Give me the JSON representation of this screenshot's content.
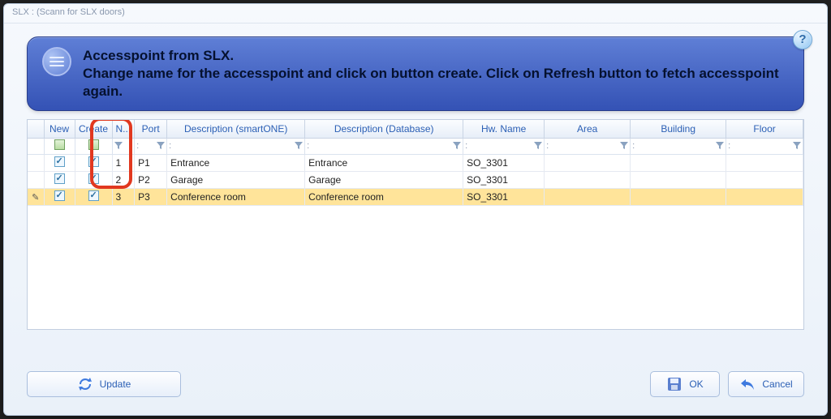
{
  "title": "SLX :  (Scann for SLX doors)",
  "help": "?",
  "banner": {
    "line1": "Accesspoint from SLX.",
    "line2": "Change name for the accesspoint and click on button create. Click on Refresh button to fetch accesspoint again."
  },
  "columns": {
    "new": "New",
    "create": "Create",
    "no": "N...",
    "port": "Port",
    "desc_smartone": "Description (smartONE)",
    "desc_db": "Description (Database)",
    "hw": "Hw. Name",
    "area": "Area",
    "building": "Building",
    "floor": "Floor"
  },
  "filter_placeholder": ":",
  "rows": [
    {
      "no": "1",
      "port": "P1",
      "desc1": "Entrance",
      "desc2": "Entrance",
      "hw": "SO_3301",
      "area": "",
      "bld": "",
      "floor": "",
      "sel": false
    },
    {
      "no": "2",
      "port": "P2",
      "desc1": "Garage",
      "desc2": "Garage",
      "hw": "SO_3301",
      "area": "",
      "bld": "",
      "floor": "",
      "sel": false
    },
    {
      "no": "3",
      "port": "P3",
      "desc1": "Conference room",
      "desc2": "Conference room",
      "hw": "SO_3301",
      "area": "",
      "bld": "",
      "floor": "",
      "sel": true
    }
  ],
  "buttons": {
    "update": "Update",
    "ok": "OK",
    "cancel": "Cancel"
  }
}
